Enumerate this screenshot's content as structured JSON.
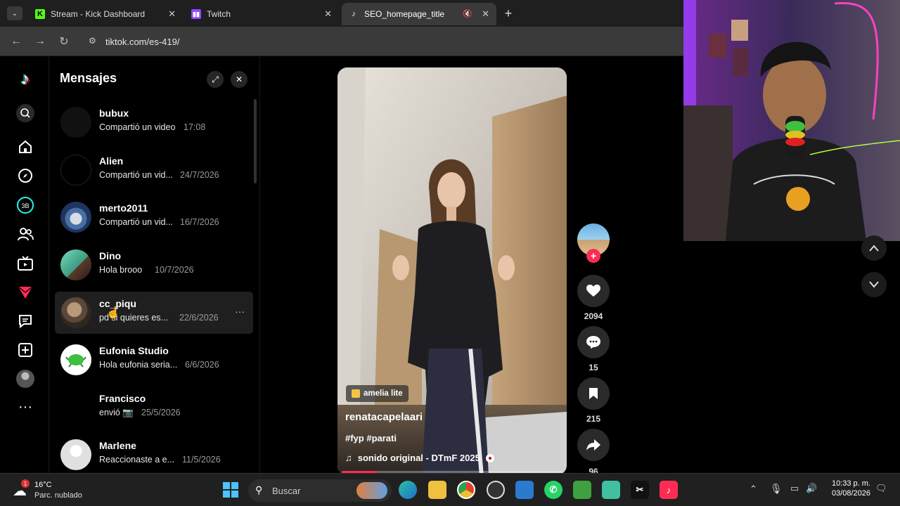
{
  "browser": {
    "tabs": [
      {
        "label": "Stream - Kick Dashboard",
        "icon": "kick-icon",
        "active": false
      },
      {
        "label": "Twitch",
        "icon": "twitch-icon",
        "active": false
      },
      {
        "label": "SEO_homepage_title",
        "icon": "tiktok-icon",
        "active": true
      }
    ],
    "url": "tiktok.com/es-419/"
  },
  "messages": {
    "title": "Mensajes",
    "conversations": [
      {
        "name": "bubux",
        "preview": "Compartió un video",
        "date": "17:08",
        "avatar_color": "#111111"
      },
      {
        "name": "Alien",
        "preview": "Compartió un vid...",
        "date": "24/7/2026",
        "avatar_color": "#0a0a0a"
      },
      {
        "name": "merto2011",
        "preview": "Compartió un vid...",
        "date": "16/7/2026",
        "avatar_color": "#3a5a8a"
      },
      {
        "name": "Dino",
        "preview": "Hola brooo",
        "date": "10/7/2026",
        "avatar_color": "#4aaf8f"
      },
      {
        "name": "cc_piqu",
        "preview": "pd si quieres es...",
        "date": "22/6/2026",
        "avatar_color": "#6b5a48"
      },
      {
        "name": "Eufonia Studio",
        "preview": "Hola eufonia seria...",
        "date": "6/6/2026",
        "avatar_color": "#ffffff"
      },
      {
        "name": "Francisco",
        "preview": "envió 📷",
        "date": "25/5/2026",
        "avatar_color": "#000000"
      },
      {
        "name": "Marlene",
        "preview": "Reaccionaste a e...",
        "date": "11/5/2026",
        "avatar_color": "#e0e0e0"
      }
    ]
  },
  "video": {
    "badge": "amelia lite",
    "author": "renatacapelaari",
    "hashtags": "#fyp #parati",
    "sound": "sonido original - DTmF 2025",
    "likes": "2094",
    "comments": "15",
    "saves": "215",
    "shares": "96"
  },
  "taskbar": {
    "weather_temp": "16°C",
    "weather_desc": "Parc. nublado",
    "search_placeholder": "Buscar",
    "time": "10:33 p. m.",
    "date": "03/08/2026"
  }
}
